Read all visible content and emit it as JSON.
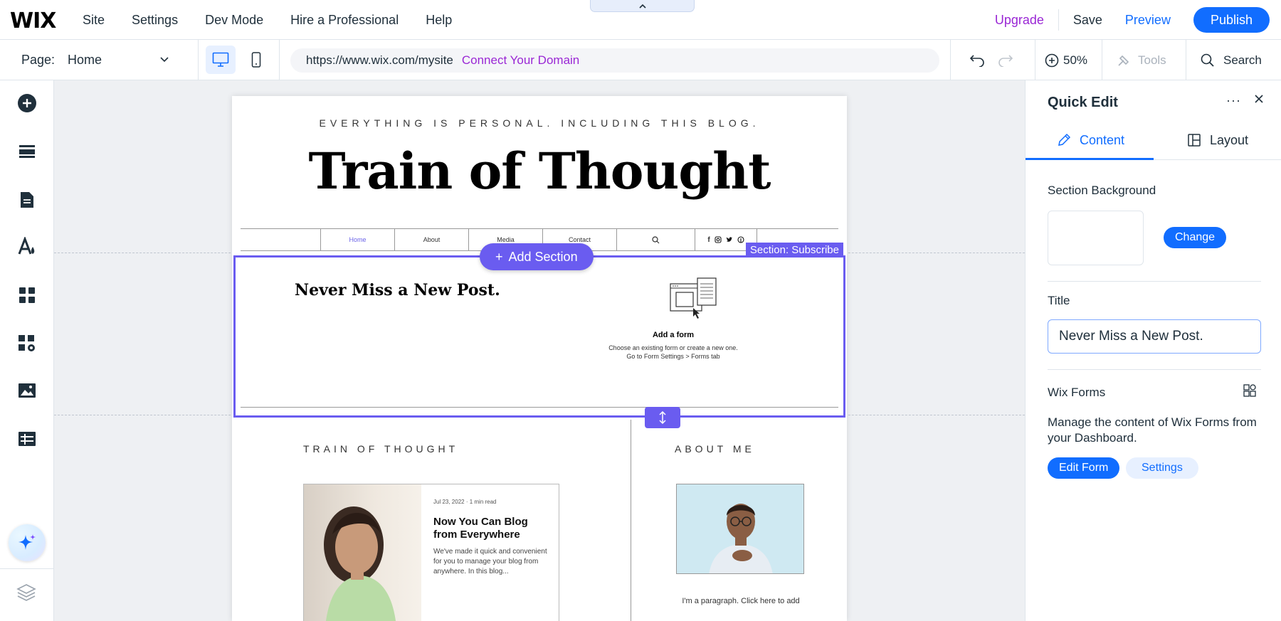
{
  "app": {
    "logo": "WIX"
  },
  "topnav": {
    "items": [
      "Site",
      "Settings",
      "Dev Mode",
      "Hire a Professional",
      "Help"
    ],
    "upgrade": "Upgrade",
    "save": "Save",
    "preview": "Preview",
    "publish": "Publish"
  },
  "toolbar": {
    "page_label": "Page:",
    "page_value": "Home",
    "url": "https://www.wix.com/mysite",
    "connect_domain": "Connect Your Domain",
    "zoom": "50%",
    "tools": "Tools",
    "search": "Search"
  },
  "leftbar": {
    "icons": [
      "add-elements-icon",
      "sections-icon",
      "pages-icon",
      "site-design-icon",
      "apps-icon",
      "business-tools-icon",
      "media-icon",
      "cms-icon",
      "ai-assistant-icon",
      "layers-icon"
    ]
  },
  "site": {
    "tagline": "EVERYTHING IS PERSONAL. INCLUDING THIS BLOG.",
    "title": "Train of Thought",
    "nav": [
      "Home",
      "About",
      "Media",
      "Contact"
    ],
    "section_label": "Section: Subscribe",
    "add_section": "Add Section",
    "subscribe_title": "Never Miss a New Post.",
    "add_form_title": "Add a form",
    "add_form_line1": "Choose an existing form or create a new one.",
    "add_form_line2": "Go to Form Settings > Forms tab",
    "blog_heading": "TRAIN OF THOUGHT",
    "about_heading": "ABOUT ME",
    "blog_meta": "Jul 23, 2022  ·  1 min read",
    "blog_post_title": "Now You Can Blog from Everywhere",
    "blog_excerpt": "We've made it quick and convenient for you to manage your blog from anywhere. In this blog...",
    "about_para": "I'm a paragraph. Click here to add"
  },
  "panel": {
    "title": "Quick Edit",
    "more": "···",
    "tabs": [
      "Content",
      "Layout"
    ],
    "section_background": "Section Background",
    "change": "Change",
    "title_label": "Title",
    "title_value": "Never Miss a New Post.",
    "wix_forms": "Wix Forms",
    "wix_forms_desc": "Manage the content of Wix Forms from your Dashboard.",
    "edit_form": "Edit Form",
    "settings": "Settings"
  },
  "colors": {
    "accent": "#116dff",
    "selection": "#6a5cf0",
    "upgrade": "#9a27d5"
  }
}
